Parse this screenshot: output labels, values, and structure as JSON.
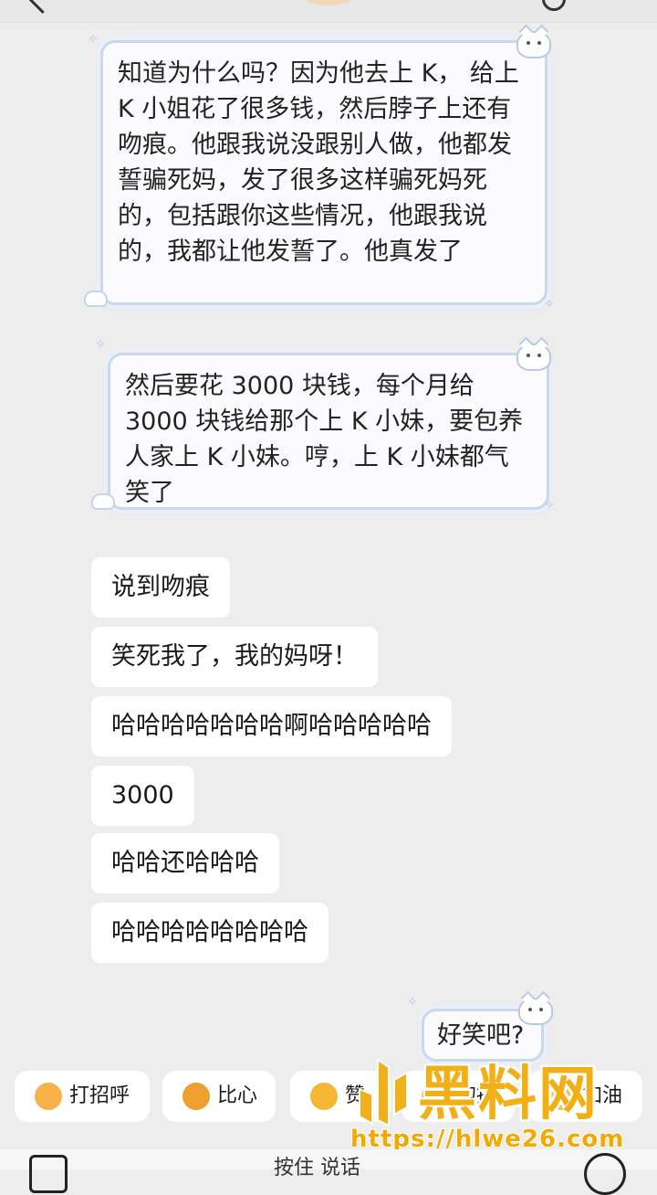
{
  "chat": {
    "sent": [
      "知道为什么吗？因为他去上 K， 给上 K 小姐花了很多钱，然后脖子上还有吻痕。他跟我说没跟别人做，他都发誓骗死妈，发了很多这样骗死妈死的，包括跟你这些情况，他跟我说的，我都让他发誓了。他真发了",
      "然后要花 3000 块钱，每个月给 3000 块钱给那个上 K 小妹，要包养人家上 K 小妹。哼，上 K 小妹都气笑了",
      "好笑吧?"
    ],
    "received": [
      "说到吻痕",
      "笑死我了，我的妈呀！",
      "哈哈哈哈哈哈哈啊哈哈哈哈哈",
      "3000",
      "哈哈还哈哈哈",
      "哈哈哈哈哈哈哈哈"
    ]
  },
  "quick_replies": {
    "greet": "打招呼",
    "heart": "比心",
    "thumb": "赞",
    "hug": "抱抱",
    "cheer": "加油"
  },
  "input": {
    "placeholder": "按住 说话"
  },
  "watermark": {
    "title": "黑料网",
    "url": "https://hlwe26.com"
  },
  "colors": {
    "background": "#ededed",
    "bubble_border": "#c9d8ee",
    "watermark": "#f2b018"
  }
}
